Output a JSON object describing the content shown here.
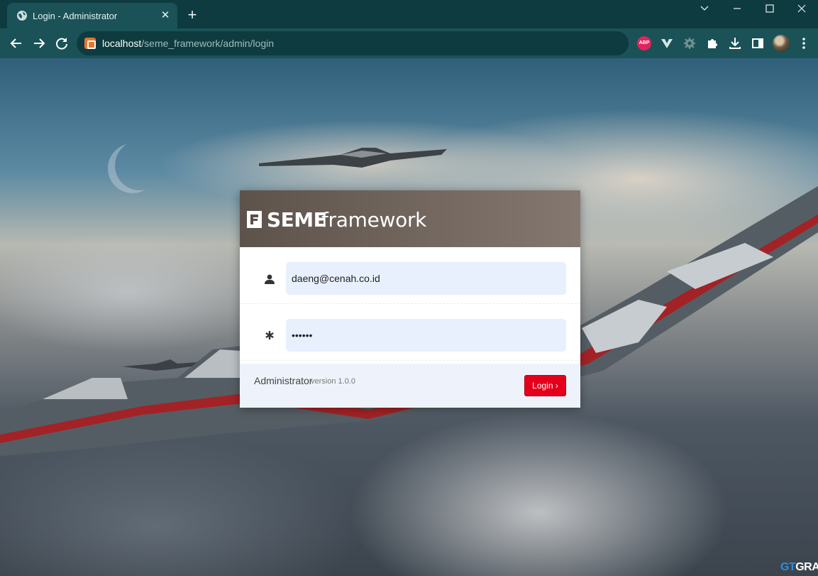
{
  "browser": {
    "tab_title": "Login - Administrator",
    "url_host": "localhost",
    "url_path": "/seme_framework/admin/login",
    "extension_abp": "ABP"
  },
  "login": {
    "logo_bold": "SEME",
    "logo_light": "framework",
    "email_value": "daeng@cenah.co.id",
    "password_value": "••••••",
    "footer_title": "Administrator",
    "footer_version": "version 1.0.0",
    "login_button": "Login ›"
  },
  "watermark": {
    "gt": "GT",
    "rest": "GRA"
  },
  "colors": {
    "browser_frame": "#0e3b3f",
    "active_tab": "#1a5257",
    "login_button": "#e4001b",
    "input_fill": "#e8f0fe"
  },
  "icons": [
    "globe-icon",
    "close-icon",
    "plus-icon",
    "chevron-down-icon",
    "minimize-icon",
    "maximize-icon",
    "back-icon",
    "forward-icon",
    "reload-icon",
    "site-icon",
    "adblock-icon",
    "vivaldi-icon",
    "gear-icon",
    "puzzle-icon",
    "download-icon",
    "sidepanel-icon",
    "avatar",
    "more-icon",
    "user-icon",
    "asterisk-icon",
    "logo-icon"
  ]
}
